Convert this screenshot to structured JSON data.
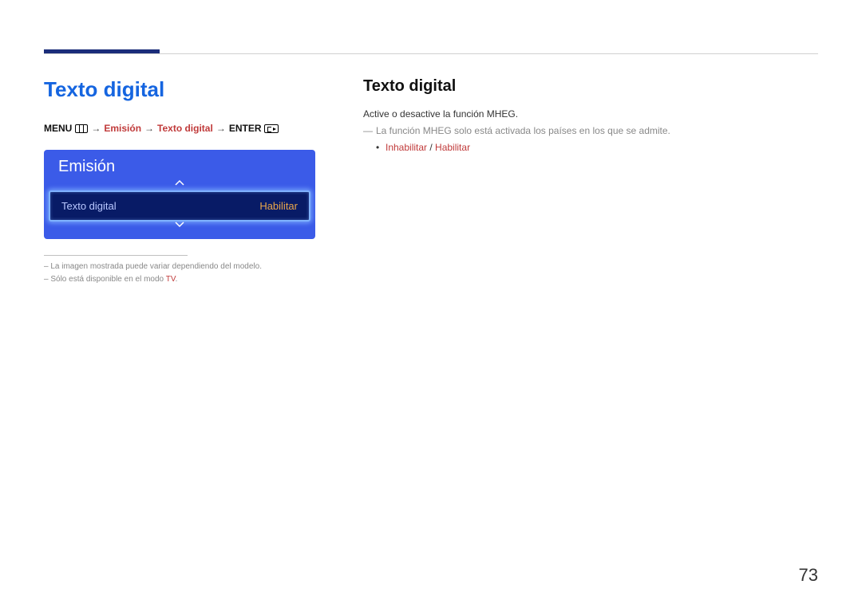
{
  "left": {
    "section_title": "Texto digital",
    "breadcrumb": {
      "menu": "MENU",
      "emision": "Emisión",
      "texto_digital": "Texto digital",
      "enter": "ENTER"
    },
    "osd": {
      "title": "Emisión",
      "item_label": "Texto digital",
      "item_value": "Habilitar"
    },
    "footnote1_prefix": "– ",
    "footnote1": "La imagen mostrada puede variar dependiendo del modelo.",
    "footnote2_prefix": "– ",
    "footnote2_a": "Sólo está disponible en el modo ",
    "footnote2_tv": "TV",
    "footnote2_b": "."
  },
  "right": {
    "title": "Texto digital",
    "body1": "Active o desactive la función MHEG.",
    "note": "La función MHEG solo está activada los países en los que se admite.",
    "opt_a": "Inhabilitar",
    "opt_sep": " / ",
    "opt_b": "Habilitar"
  },
  "page_number": "73"
}
